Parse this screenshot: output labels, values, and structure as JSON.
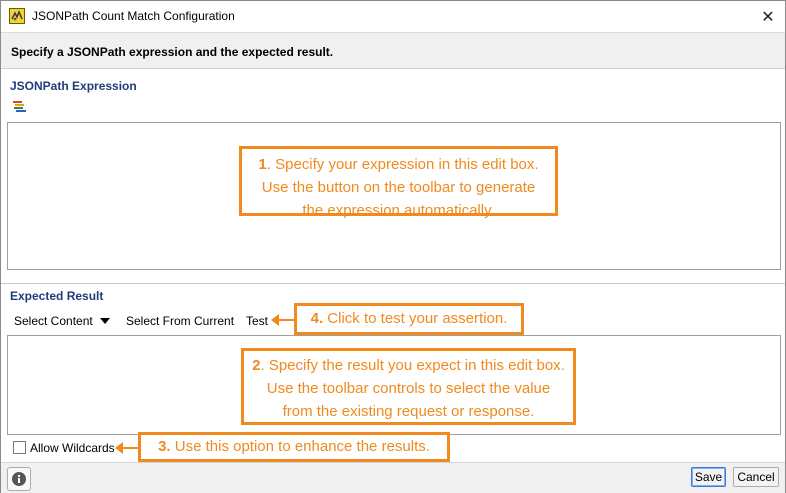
{
  "window": {
    "title": "JSONPath Count Match Configuration",
    "close_glyph": "✕"
  },
  "header": {
    "text": "Specify a JSONPath expression and the expected result."
  },
  "expression": {
    "section_label": "JSONPath Expression",
    "value": ""
  },
  "expected": {
    "section_label": "Expected Result",
    "toolbar": {
      "select_content": "Select Content",
      "select_from_current": "Select From Current",
      "test": "Test"
    },
    "value": ""
  },
  "options": {
    "allow_wildcards_label": "Allow Wildcards",
    "allow_wildcards_checked": false
  },
  "callouts": {
    "c1": {
      "num": "1",
      "text": ". Specify your expression in this edit box. Use the button on the toolbar to generate the expression automatically."
    },
    "c2": {
      "num": "2",
      "text": ". Specify the result you expect in this edit box. Use the toolbar controls to select the value from the existing request or response."
    },
    "c3": {
      "num": "3.",
      "text": " Use this option to enhance the results."
    },
    "c4": {
      "num": "4.",
      "text": " Click to test your assertion."
    }
  },
  "footer": {
    "save_label": "Save",
    "cancel_label": "Cancel",
    "info_glyph": "i"
  },
  "colors": {
    "callout": "#f08a1e",
    "section_label": "#1f3d7a"
  }
}
